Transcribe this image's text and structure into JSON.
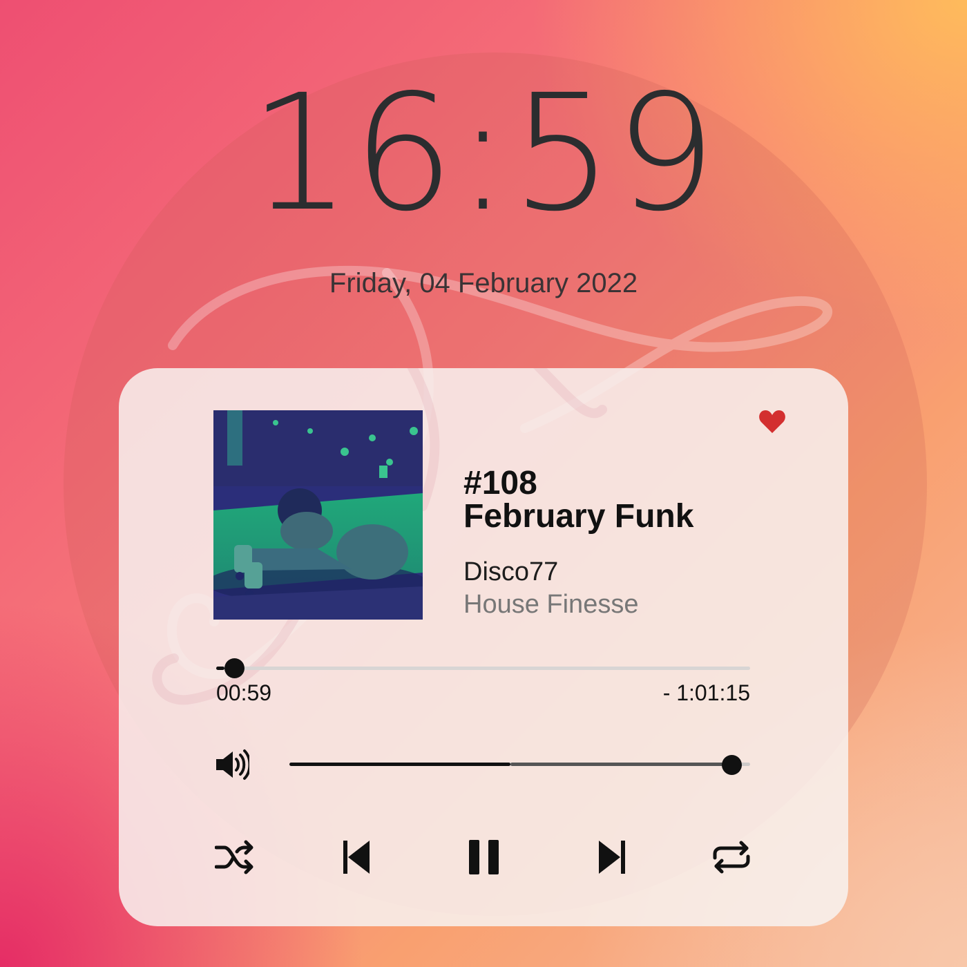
{
  "lockscreen": {
    "time": "16:59",
    "date": "Friday, 04 February 2022"
  },
  "player": {
    "favorite": true,
    "favorite_icon": "heart-icon",
    "track_number": "#108",
    "title": "February Funk",
    "artist": "Disco77",
    "genre": "House Finesse",
    "progress": {
      "elapsed": "00:59",
      "remaining": "- 1:01:15",
      "fraction": 0.016
    },
    "volume": {
      "icon": "volume-icon",
      "level": 0.96
    },
    "controls": [
      "shuffle-icon",
      "previous-icon",
      "pause-icon",
      "next-icon",
      "repeat-icon"
    ]
  },
  "colors": {
    "accent_heart": "#d32f2f",
    "text_dark": "#111111",
    "text_muted": "#777777"
  }
}
